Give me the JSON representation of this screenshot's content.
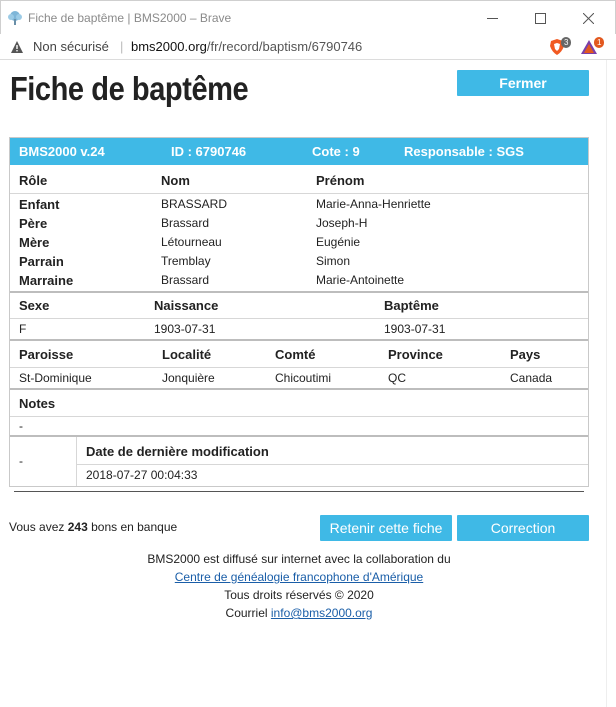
{
  "window": {
    "title": "Fiche de baptême | BMS2000 – Brave",
    "security_label": "Non sécurisé",
    "url_domain": "bms2000.org",
    "url_path": "/fr/record/baptism/6790746",
    "shields_count": "3",
    "rewards_count": "1"
  },
  "page": {
    "title": "Fiche de baptême",
    "close_button": "Fermer"
  },
  "record_header": {
    "version": "BMS2000 v.24",
    "id": "ID : 6790746",
    "cote": "Cote : 9",
    "responsable": "Responsable : SGS"
  },
  "persons": {
    "headers": [
      "Rôle",
      "Nom",
      "Prénom"
    ],
    "rows": [
      {
        "role": "Enfant",
        "nom": "BRASSARD",
        "prenom": "Marie-Anna-Henriette"
      },
      {
        "role": "Père",
        "nom": "Brassard",
        "prenom": "Joseph-H"
      },
      {
        "role": "Mère",
        "nom": "Létourneau",
        "prenom": "Eugénie"
      },
      {
        "role": "Parrain",
        "nom": "Tremblay",
        "prenom": "Simon"
      },
      {
        "role": "Marraine",
        "nom": "Brassard",
        "prenom": "Marie-Antoinette"
      }
    ]
  },
  "vitals": {
    "headers": [
      "Sexe",
      "Naissance",
      "Baptême"
    ],
    "values": [
      "F",
      "1903-07-31",
      "1903-07-31"
    ]
  },
  "place": {
    "headers": [
      "Paroisse",
      "Localité",
      "Comté",
      "Province",
      "Pays"
    ],
    "values": [
      "St-Dominique",
      "Jonquière",
      "Chicoutimi",
      "QC",
      "Canada"
    ]
  },
  "notes": {
    "label": "Notes",
    "value": "-"
  },
  "modification": {
    "left_value": "-",
    "label": "Date de dernière modification",
    "value": "2018-07-27 00:04:33"
  },
  "footer": {
    "bank_prefix": "Vous avez",
    "bank_count": "243",
    "bank_suffix": "bons en banque",
    "save_button": "Retenir cette fiche",
    "correction_button": "Correction",
    "line1": "BMS2000 est diffusé sur internet avec la collaboration du",
    "link": "Centre de généalogie francophone d'Amérique",
    "line3": "Tous droits réservés © 2020",
    "mail_prefix": "Courriel",
    "mail": "info@bms2000.org"
  }
}
